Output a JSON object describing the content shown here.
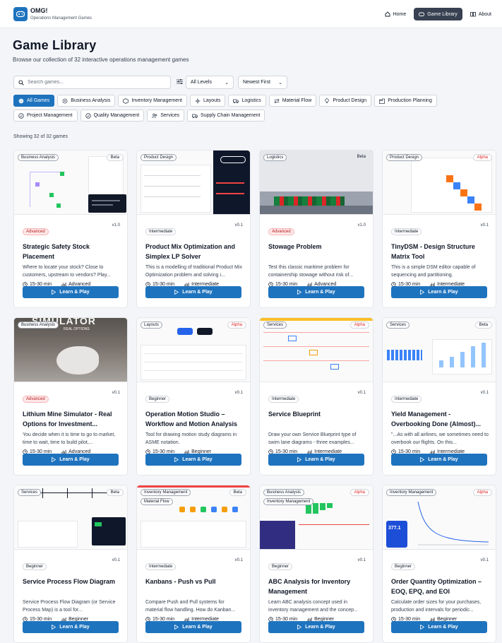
{
  "app": {
    "name": "OMG!",
    "tagline": "Operations Management Games"
  },
  "nav": [
    {
      "label": "Home",
      "icon": "home-icon"
    },
    {
      "label": "Game Library",
      "icon": "library-icon"
    },
    {
      "label": "About",
      "icon": "book-icon"
    }
  ],
  "page": {
    "title": "Game Library",
    "subtitle": "Browse our collection of 32 interactive operations management games"
  },
  "search": {
    "placeholder": "Search games...",
    "value": ""
  },
  "filters": {
    "level": "All Levels",
    "sort": "Newest First"
  },
  "categories": [
    "All Games",
    "Business Analysis",
    "Inventory Management",
    "Layouts",
    "Logistics",
    "Material Flow",
    "Product Design",
    "Production Planning",
    "Project Management",
    "Quality Management",
    "Services",
    "Supply Chain Management"
  ],
  "showing": "Showing 32 of 32 games",
  "play_label": "Learn & Play",
  "games": [
    {
      "tags": [
        "Business Analysis"
      ],
      "status": "Beta",
      "level": "Advanced",
      "version": "v1.0",
      "title": "Strategic Safety Stock Placement",
      "desc": "Where to locate your stock? Close to customers, upstream to vendors? Play...",
      "time": "15-30 min",
      "difficulty": "Advanced"
    },
    {
      "tags": [
        "Product Design"
      ],
      "status": "",
      "level": "Intermediate",
      "version": "v0.1",
      "title": "Product Mix Optimization and Simplex LP Solver",
      "desc": "This is a modelling of traditional Product Mix Optimization problem and solving i...",
      "time": "15-30 min",
      "difficulty": "Intermediate"
    },
    {
      "tags": [
        "Logistics"
      ],
      "status": "Beta",
      "level": "Advanced",
      "version": "v1.0",
      "title": "Stowage Problem",
      "desc": "Test this classic maritime problem for containership stowage without risk of...",
      "time": "15-30 min",
      "difficulty": "Advanced"
    },
    {
      "tags": [
        "Product Design"
      ],
      "status": "Alpha",
      "level": "Intermediate",
      "version": "v0.1",
      "title": "TinyDSM - Design Structure Matrix Tool",
      "desc": "This is a simple DSM editor capable of sequencing and partitioning.",
      "time": "15-30 min",
      "difficulty": "Intermediate"
    },
    {
      "tags": [
        "Business Analysis"
      ],
      "status": "",
      "level": "Advanced",
      "version": "v0.1",
      "title": "Lithium Mine Simulator - Real Options for Investment...",
      "desc": "You decide when it is time to go to market, time to wait, time to build pilot,...",
      "time": "15-30 min",
      "difficulty": "Advanced"
    },
    {
      "tags": [
        "Layouts"
      ],
      "status": "Alpha",
      "level": "Beginner",
      "version": "v0.1",
      "title": "Operation Motion Studio – Workflow and Motion Analysis",
      "desc": "Tool for drawing motion study diagrams in ASME notation.",
      "time": "15-30 min",
      "difficulty": "Beginner"
    },
    {
      "tags": [
        "Services"
      ],
      "status": "Alpha",
      "level": "Intermediate",
      "version": "v0.1",
      "title": "Service Blueprint",
      "desc": "Draw your own Service Blueprint type of swim lane diagrams - three examples...",
      "time": "15-30 min",
      "difficulty": "Intermediate"
    },
    {
      "tags": [
        "Services"
      ],
      "status": "Beta",
      "level": "Intermediate",
      "version": "v0.1",
      "title": "Yield Management - Overbooking Done (Almost)...",
      "desc": "\"...As with all airlines, we sometimes need to overbook our flights. On this...",
      "time": "15-30 min",
      "difficulty": "Intermediate"
    },
    {
      "tags": [
        "Services"
      ],
      "status": "Beta",
      "level": "Beginner",
      "version": "v0.1",
      "title": "Service Process Flow Diagram",
      "desc": "Service Process Flow Diagram (or Service Process Map) is a tool for...",
      "time": "15-30 min",
      "difficulty": "Beginner"
    },
    {
      "tags": [
        "Inventory Management",
        "Material Flow"
      ],
      "status": "Beta",
      "level": "Intermediate",
      "version": "v0.1",
      "title": "Kanbans - Push vs Pull",
      "desc": "Compare Push and Pull systems for material flow handling. How do Kanban...",
      "time": "15-30 min",
      "difficulty": "Intermediate"
    },
    {
      "tags": [
        "Business Analysis",
        "Inventory Management"
      ],
      "status": "Alpha",
      "level": "Beginner",
      "version": "v0.1",
      "title": "ABC Analysis for Inventory Management",
      "desc": "Learn ABC analysis concept used in inventory management and the concep...",
      "time": "15-30 min",
      "difficulty": "Beginner"
    },
    {
      "tags": [
        "Inventory Management"
      ],
      "status": "Alpha",
      "level": "Beginner",
      "version": "v0.1",
      "title": "Order Quantity Optimization – EOQ, EPQ, and EOI",
      "desc": "Calculate order sizes for your purchases, production and intervals for periodic...",
      "time": "15-30 min",
      "difficulty": "Beginner"
    }
  ],
  "thumb_text": {
    "lithium": "SIMULATOR",
    "lithium_sub": "REAL OPTIONS",
    "eoq_value": "377.1"
  },
  "colors": {
    "primary": "#1e73be",
    "alpha": "#dc2626",
    "advanced_bg": "#fde8e8"
  }
}
